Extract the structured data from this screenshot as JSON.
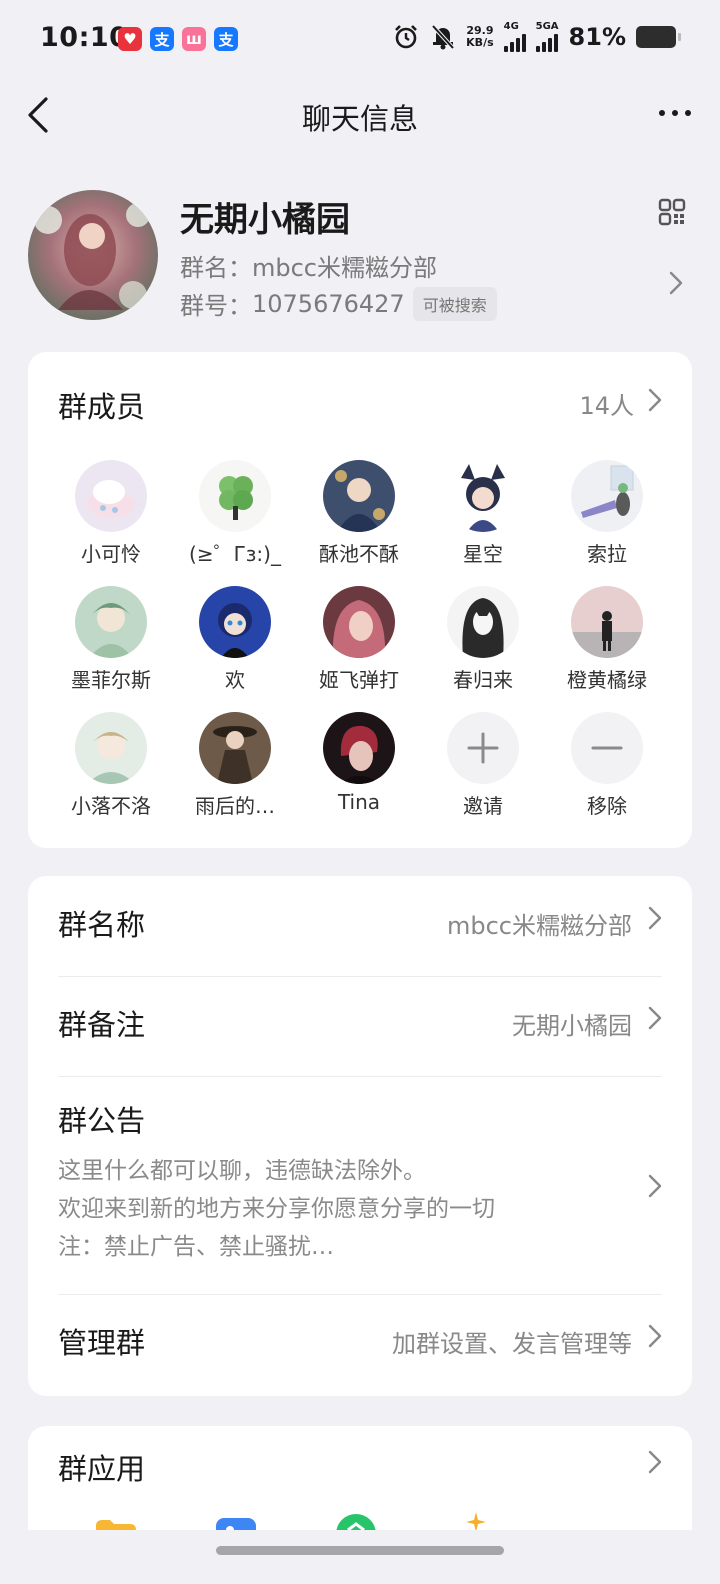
{
  "status_bar": {
    "time": "10:10",
    "apps": [
      {
        "icon": "heart-app-icon",
        "glyph": "♥",
        "color": "#e8333c"
      },
      {
        "icon": "alipay-icon",
        "glyph": "支",
        "color": "#1677ff"
      },
      {
        "icon": "bilibili-icon",
        "glyph": "ш",
        "color": "#fb7299"
      },
      {
        "icon": "alipay-icon-2",
        "glyph": "支",
        "color": "#1677ff"
      }
    ],
    "speed_value": "29.9",
    "speed_unit": "KB/s",
    "net_1": "4G",
    "net_2": "5GA",
    "battery": "81%"
  },
  "header": {
    "title": "聊天信息"
  },
  "group": {
    "title": "无期小橘园",
    "name_label": "群名：",
    "name_value": "mbcc米糯糍分部",
    "id_label": "群号：",
    "id_value": "1075676427",
    "search_badge": "可被搜索"
  },
  "members": {
    "title": "群成员",
    "count": "14人",
    "list": [
      {
        "name": "小可怜"
      },
      {
        "name": "(≥゜Гз:)_"
      },
      {
        "name": "酥池不酥"
      },
      {
        "name": "星空"
      },
      {
        "name": "索拉"
      },
      {
        "name": "墨菲尔斯"
      },
      {
        "name": "欢"
      },
      {
        "name": "姬飞弹打"
      },
      {
        "name": "春归来"
      },
      {
        "name": "橙黄橘绿"
      },
      {
        "name": "小落不洛"
      },
      {
        "name": "雨后的…"
      },
      {
        "name": "Tina"
      }
    ],
    "invite_label": "邀请",
    "remove_label": "移除"
  },
  "settings": {
    "group_name_label": "群名称",
    "group_name_value": "mbcc米糯糍分部",
    "group_remark_label": "群备注",
    "group_remark_value": "无期小橘园",
    "notice_label": "群公告",
    "notice_lines": [
      "这里什么都可以聊，违德缺法除外。",
      "欢迎来到新的地方来分享你愿意分享的一切",
      "注：禁止广告、禁止骚扰…"
    ],
    "manage_label": "管理群",
    "manage_value": "加群设置、发言管理等"
  },
  "apps": {
    "title": "群应用"
  },
  "colors": {
    "background": "#f0f0f5",
    "card": "#ffffff",
    "secondary_text": "#888888"
  }
}
